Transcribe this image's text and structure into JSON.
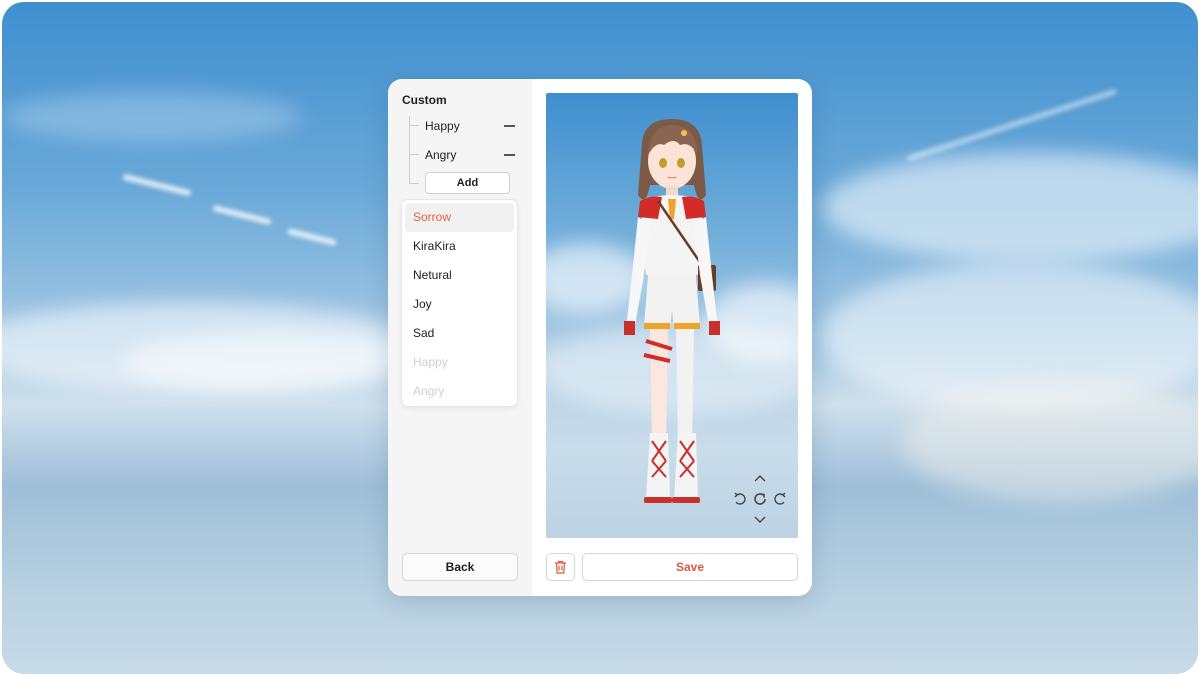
{
  "custom": {
    "title": "Custom",
    "items": [
      {
        "label": "Happy"
      },
      {
        "label": "Angry"
      }
    ],
    "add_label": "Add"
  },
  "dropdown": {
    "options": [
      {
        "label": "Sorrow",
        "state": "selected"
      },
      {
        "label": "KiraKira",
        "state": "normal"
      },
      {
        "label": "Netural",
        "state": "normal"
      },
      {
        "label": "Joy",
        "state": "normal"
      },
      {
        "label": "Sad",
        "state": "normal"
      },
      {
        "label": "Happy",
        "state": "disabled"
      },
      {
        "label": "Angry",
        "state": "disabled"
      }
    ]
  },
  "footer": {
    "back_label": "Back",
    "save_label": "Save",
    "delete_icon": "trash-icon"
  },
  "camera": {
    "icons": [
      "chevron-up-icon",
      "rotate-left-icon",
      "reset-rotation-icon",
      "rotate-right-icon",
      "chevron-down-icon"
    ]
  },
  "colors": {
    "accent": "#d9593c",
    "selected_text": "#e06140",
    "disabled_text": "#cfcfcf"
  }
}
